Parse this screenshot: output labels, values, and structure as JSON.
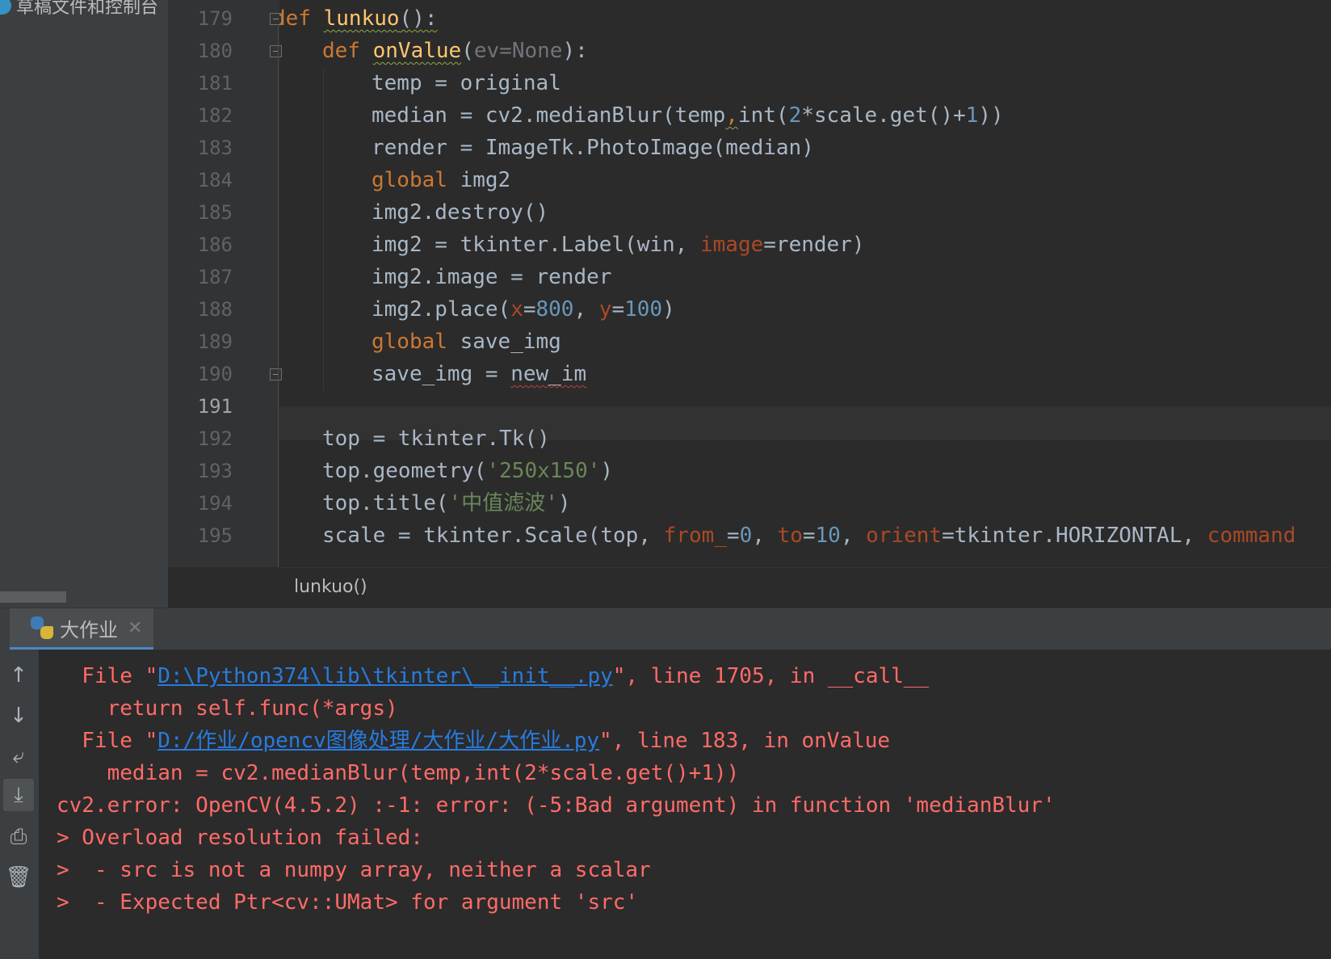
{
  "project_panel": {
    "item_label": "草稿文件和控制台"
  },
  "editor": {
    "current_line": "191",
    "lines": [
      {
        "n": "179"
      },
      {
        "n": "180"
      },
      {
        "n": "181"
      },
      {
        "n": "182"
      },
      {
        "n": "183"
      },
      {
        "n": "184"
      },
      {
        "n": "185"
      },
      {
        "n": "186"
      },
      {
        "n": "187"
      },
      {
        "n": "188"
      },
      {
        "n": "189"
      },
      {
        "n": "190"
      },
      {
        "n": "191"
      },
      {
        "n": "192"
      },
      {
        "n": "193"
      },
      {
        "n": "194"
      },
      {
        "n": "195"
      }
    ],
    "code": {
      "l179": {
        "kw": "def",
        "fn": "lunkuo",
        "rest": "():"
      },
      "l180": {
        "kw": "def",
        "fn": "onValue",
        "p1": "(",
        "param": "ev=None",
        "p2": "):"
      },
      "l181": "temp = original",
      "l182": {
        "a": "median = cv2.medianBlur(temp",
        "comma": ",",
        "b": "int(",
        "num1": "2",
        "c": "*scale.get()+",
        "num2": "1",
        "d": "))"
      },
      "l183": "render = ImageTk.PhotoImage(median)",
      "l184": {
        "kw": "global",
        "rest": " img2"
      },
      "l185": "img2.destroy()",
      "l186": {
        "a": "img2 = tkinter.Label(win, ",
        "param": "image",
        "b": "=render)"
      },
      "l187": "img2.image = render",
      "l188": {
        "a": "img2.place(",
        "px": "x",
        "eq1": "=",
        "n1": "800",
        "comma": ", ",
        "py": "y",
        "eq2": "=",
        "n2": "100",
        "close": ")"
      },
      "l189": {
        "kw": "global",
        "rest": " save_img"
      },
      "l190": {
        "a": "save_img = ",
        "err": "new_im"
      },
      "l192": "top = tkinter.Tk()",
      "l193": {
        "a": "top.geometry(",
        "str": "'250x150'",
        "close": ")"
      },
      "l194": {
        "a": "top.title(",
        "str": "'中值滤波'",
        "close": ")"
      },
      "l195": {
        "a": "scale = tkinter.Scale(top, ",
        "p_from": "from_",
        "eq1": "=",
        "n1": "0",
        "c1": ", ",
        "p_to": "to",
        "eq2": "=",
        "n2": "10",
        "c2": ", ",
        "p_orient": "orient",
        "b": "=tkinter.HORIZONTAL, ",
        "p_cmd": "command"
      }
    }
  },
  "breadcrumb": "lunkuo()",
  "run_tab": {
    "label": "大作业"
  },
  "console": {
    "l1": {
      "a": "  File \"",
      "link": "D:\\Python374\\lib\\tkinter\\__init__.py",
      "b": "\", line 1705, in __call__"
    },
    "l2": "    return self.func(*args)",
    "l3": {
      "a": "  File \"",
      "link": "D:/作业/opencv图像处理/大作业/大作业.py",
      "b": "\", line 183, in onValue"
    },
    "l4": "    median = cv2.medianBlur(temp,int(2*scale.get()+1))",
    "l5": "cv2.error: OpenCV(4.5.2) :-1: error: (-5:Bad argument) in function 'medianBlur'",
    "l6": "> Overload resolution failed:",
    "l7": ">  - src is not a numpy array, neither a scalar",
    "l8": ">  - Expected Ptr<cv::UMat> for argument 'src'"
  }
}
